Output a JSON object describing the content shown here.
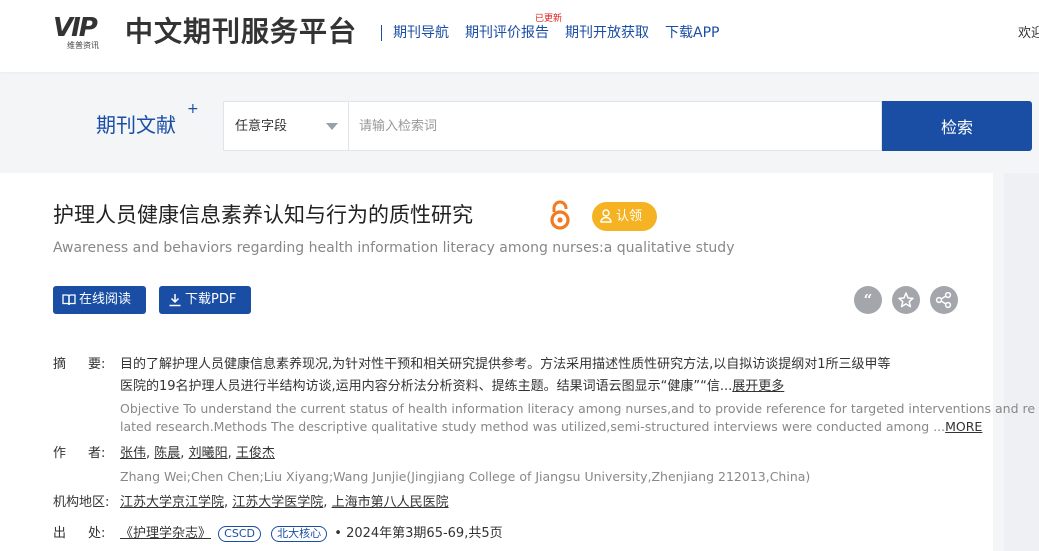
{
  "header": {
    "logo_text": "VIP",
    "logo_sub": "维普资讯",
    "brand": "中文期刊服务平台",
    "nav": [
      "期刊导航",
      "期刊评价报告",
      "期刊开放获取",
      "下载APP"
    ],
    "nav_badge": "已更新",
    "welcome": "欢迎"
  },
  "search": {
    "label": "期刊文献",
    "label_sup": "+",
    "field": "任意字段",
    "placeholder": "请输入检索词",
    "button": "检索"
  },
  "article": {
    "title": "护理人员健康信息素养认知与行为的质性研究",
    "claim": "认领",
    "subtitle": "Awareness and behaviors regarding health information literacy among nurses:a qualitative study",
    "btn_read": "在线阅读",
    "btn_pdf": "下载PDF",
    "abstract_label_a": "摘",
    "abstract_label_b": "要:",
    "abstract_cn_1": "目的了解护理人员健康信息素养现况,为针对性干预和相关研究提供参考。方法采用描述性质性研究方法,以自拟访谈提纲对1所三级甲等",
    "abstract_cn_2": "医院的19名护理人员进行半结构访谈,运用内容分析法分析资料、提练主题。结果词语云图显示“健康”“信...",
    "abstract_cn_more": "展开更多",
    "abstract_en_1": "Objective To understand the current status of health information literacy among nurses,and to provide reference for targeted interventions and re",
    "abstract_en_2": "lated research.Methods The descriptive qualitative study method was utilized,semi-structured interviews were conducted among ...",
    "abstract_en_more": "MORE",
    "author_label_a": "作",
    "author_label_b": "者:",
    "authors": [
      "张伟",
      "陈晨",
      "刘曦阳",
      "王俊杰"
    ],
    "authors_en": "Zhang Wei;Chen Chen;Liu Xiyang;Wang Junjie(Jingjiang College of Jiangsu University,Zhenjiang 212013,China)",
    "org_label": "机构地区:",
    "orgs": [
      "江苏大学京江学院",
      "江苏大学医学院",
      "上海市第八人民医院"
    ],
    "source_label_a": "出",
    "source_label_b": "处:",
    "journal": "《护理学杂志》",
    "tags": [
      "CSCD",
      "北大核心"
    ],
    "issue": "2024年第3期65-69,共5页"
  }
}
